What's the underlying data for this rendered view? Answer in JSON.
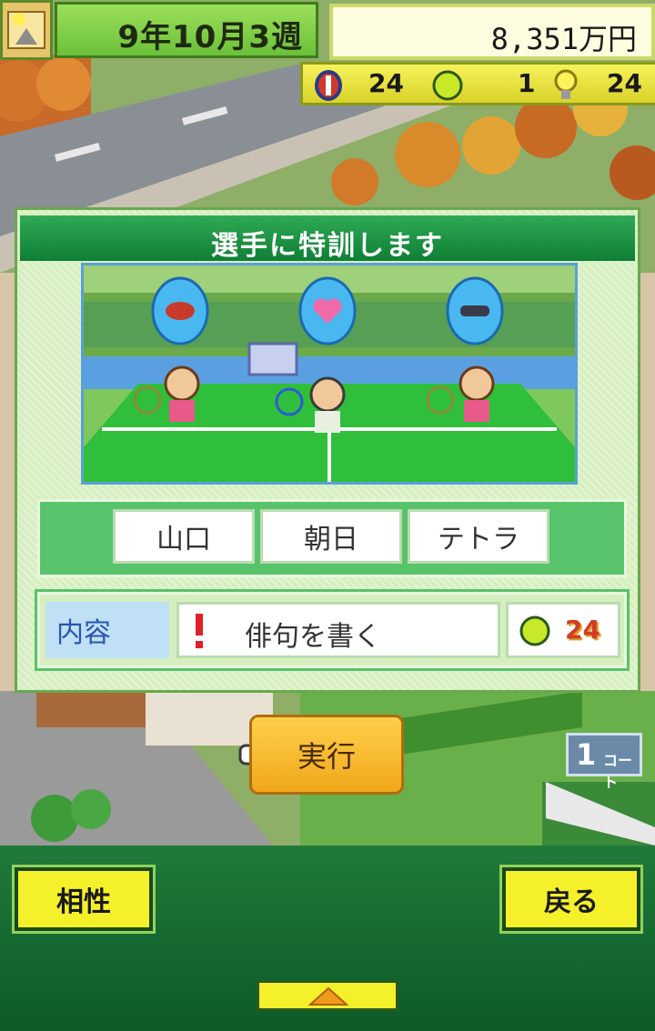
{
  "hud": {
    "date": "9年10月3週",
    "money": "8,351万円",
    "resources": {
      "shield": "24",
      "ball": "1",
      "idea": "24"
    }
  },
  "dialog": {
    "title": "選手に特訓します",
    "players": [
      "山口",
      "朝日",
      "テトラ"
    ],
    "content_label": "内容",
    "task": "俳句を書く",
    "cost": "24"
  },
  "execute_label": "実行",
  "court_sign": {
    "number": "1",
    "text": "コート"
  },
  "bottom": {
    "left_button": "相性",
    "right_button": "戻る"
  },
  "colors": {
    "header_green": "#0f7f35",
    "button_yellow": "#f4f02a",
    "execute_orange": "#f0a81c"
  }
}
